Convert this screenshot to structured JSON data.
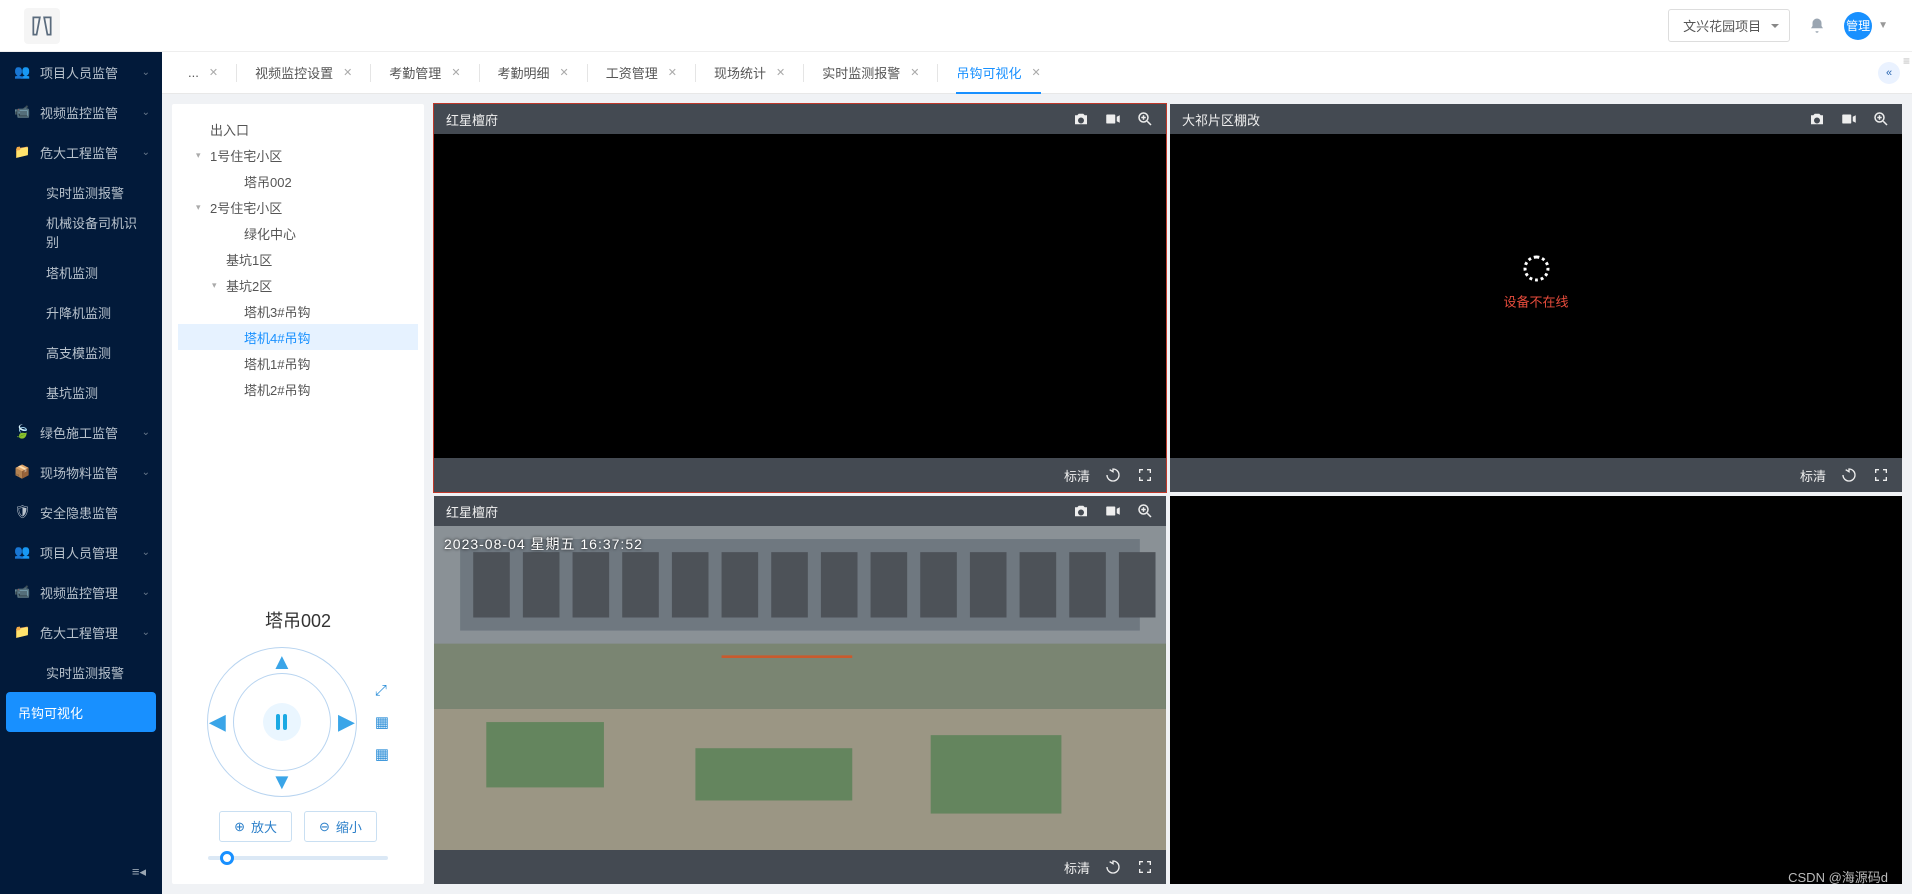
{
  "header": {
    "project_label": "文兴花园项目",
    "avatar_text": "管理"
  },
  "sidebar": {
    "items": [
      {
        "label": "项目人员监管",
        "sub": false,
        "chev": true
      },
      {
        "label": "视频监控监管",
        "sub": false,
        "chev": true
      },
      {
        "label": "危大工程监管",
        "sub": false,
        "chev": true
      },
      {
        "label": "实时监测报警",
        "sub": true,
        "chev": false
      },
      {
        "label": "机械设备司机识别",
        "sub": true,
        "chev": false
      },
      {
        "label": "塔机监测",
        "sub": true,
        "chev": false
      },
      {
        "label": "升降机监测",
        "sub": true,
        "chev": false
      },
      {
        "label": "高支模监测",
        "sub": true,
        "chev": false
      },
      {
        "label": "基坑监测",
        "sub": true,
        "chev": false
      },
      {
        "label": "绿色施工监管",
        "sub": false,
        "chev": true
      },
      {
        "label": "现场物料监管",
        "sub": false,
        "chev": true
      },
      {
        "label": "安全隐患监管",
        "sub": false,
        "chev": false
      },
      {
        "label": "项目人员管理",
        "sub": false,
        "chev": true
      },
      {
        "label": "视频监控管理",
        "sub": false,
        "chev": true
      },
      {
        "label": "危大工程管理",
        "sub": false,
        "chev": true
      },
      {
        "label": "实时监测报警",
        "sub": true,
        "chev": false
      },
      {
        "label": "吊钩可视化",
        "sub": true,
        "chev": false,
        "active": true
      }
    ]
  },
  "tabs": {
    "items": [
      {
        "label": "...",
        "close": true
      },
      {
        "label": "视频监控设置",
        "close": true
      },
      {
        "label": "考勤管理",
        "close": true
      },
      {
        "label": "考勤明细",
        "close": true
      },
      {
        "label": "工资管理",
        "close": true
      },
      {
        "label": "现场统计",
        "close": true
      },
      {
        "label": "实时监测报警",
        "close": true
      },
      {
        "label": "吊钩可视化",
        "close": true,
        "active": true
      }
    ]
  },
  "tree": {
    "nodes": [
      {
        "label": "出入口",
        "depth": 1
      },
      {
        "label": "1号住宅小区",
        "depth": 1,
        "caret": "▾"
      },
      {
        "label": "塔吊002",
        "depth": 3
      },
      {
        "label": "2号住宅小区",
        "depth": 1,
        "caret": "▾"
      },
      {
        "label": "绿化中心",
        "depth": 3
      },
      {
        "label": "基坑1区",
        "depth": 2
      },
      {
        "label": "基坑2区",
        "depth": 2,
        "caret": "▾"
      },
      {
        "label": "塔机3#吊钩",
        "depth": 3
      },
      {
        "label": "塔机4#吊钩",
        "depth": 3,
        "selected": true
      },
      {
        "label": "塔机1#吊钩",
        "depth": 3
      },
      {
        "label": "塔机2#吊钩",
        "depth": 3
      }
    ]
  },
  "ptz": {
    "title": "塔吊002",
    "zoom_in": "放大",
    "zoom_out": "缩小"
  },
  "videos": {
    "cells": [
      {
        "title": "红星檀府",
        "quality": "标清",
        "selected": true,
        "has_foot": true
      },
      {
        "title": "大祁片区棚改",
        "quality": "标清",
        "offline": true,
        "offline_text": "设备不在线",
        "has_foot": true
      },
      {
        "title": "红星檀府",
        "quality": "标清",
        "timestamp": "2023-08-04 星期五 16:37:52",
        "has_foot": true,
        "live": true
      },
      {
        "title": "",
        "quality": "",
        "blank": true
      }
    ]
  },
  "watermark": "CSDN @海源码d"
}
